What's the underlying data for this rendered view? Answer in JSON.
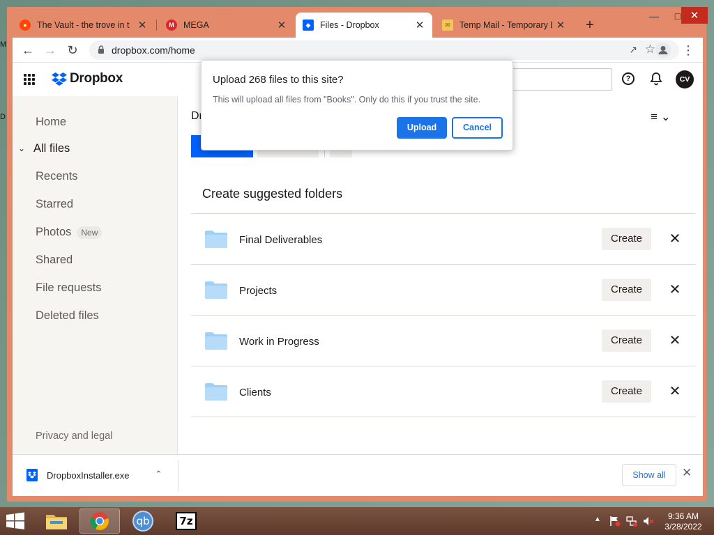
{
  "desktop": {
    "frag_top": "M",
    "frag_mid": "D"
  },
  "browser": {
    "tabs": [
      {
        "title": "The Vault - the trove in t",
        "favicon": "reddit-icon"
      },
      {
        "title": "MEGA",
        "favicon": "mega-icon"
      },
      {
        "title": "Files - Dropbox",
        "favicon": "dropbox-icon"
      },
      {
        "title": "Temp Mail - Temporary D",
        "favicon": "mail-icon"
      }
    ],
    "new_tab": "+",
    "url": "dropbox.com/home"
  },
  "header": {
    "logo": "Dropbox",
    "avatar_initials": "CV"
  },
  "sidebar": {
    "items": [
      {
        "label": "Home"
      },
      {
        "label": "All files"
      },
      {
        "label": "Recents"
      },
      {
        "label": "Starred"
      },
      {
        "label": "Photos",
        "badge": "New"
      },
      {
        "label": "Shared"
      },
      {
        "label": "File requests"
      },
      {
        "label": "Deleted files"
      }
    ],
    "footer": "Privacy and legal"
  },
  "main": {
    "breadcrumb": "Dr",
    "suggested_title": "Create suggested folders",
    "folders": [
      {
        "name": "Final Deliverables",
        "action": "Create"
      },
      {
        "name": "Projects",
        "action": "Create"
      },
      {
        "name": "Work in Progress",
        "action": "Create"
      },
      {
        "name": "Clients",
        "action": "Create"
      }
    ]
  },
  "dialog": {
    "title": "Upload 268 files to this site?",
    "message": "This will upload all files from \"Books\". Only do this if you trust the site.",
    "confirm": "Upload",
    "cancel": "Cancel"
  },
  "downloads": {
    "file": "DropboxInstaller.exe",
    "show_all": "Show all"
  },
  "taskbar": {
    "time": "9:36 AM",
    "date": "3/28/2022",
    "qb_label": "qb",
    "sevenzip_label": "7z"
  },
  "colors": {
    "accent": "#0061fe",
    "dialog_blue": "#1a73e8",
    "window_frame": "#e4896a",
    "folder": "#9fd0f6"
  }
}
